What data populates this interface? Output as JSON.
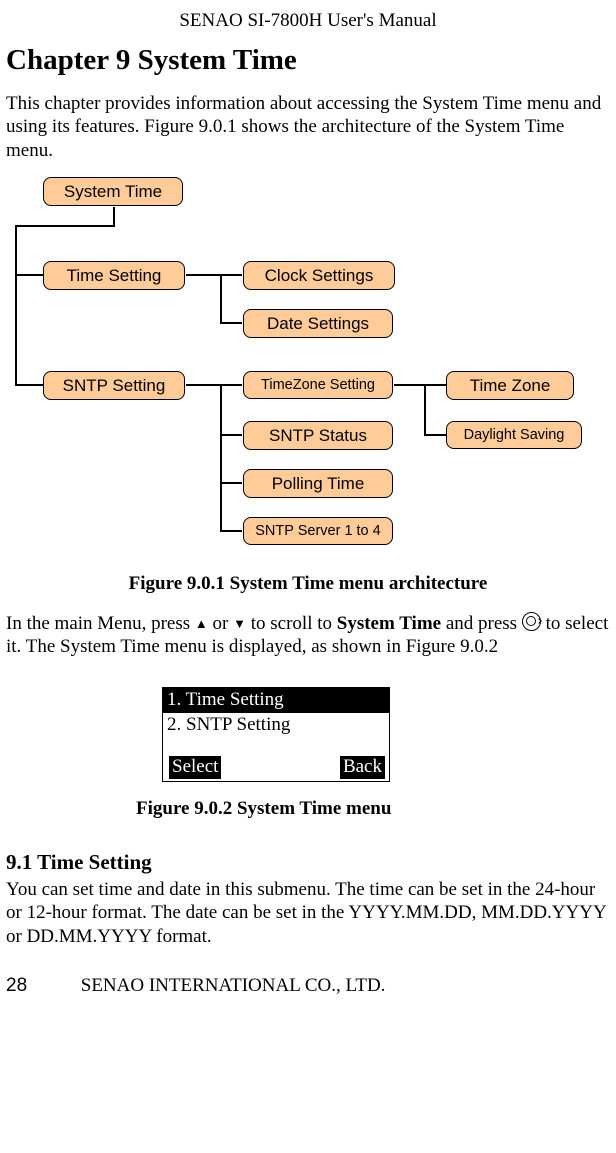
{
  "header": "SENAO SI-7800H User's Manual",
  "chapter_title": "Chapter 9 System Time",
  "intro": "This chapter provides information about accessing the System Time menu and using its features. Figure 9.0.1 shows the architecture of the System Time menu.",
  "diagram": {
    "system_time": "System Time",
    "time_setting": "Time Setting",
    "clock_settings": "Clock Settings",
    "date_settings": "Date Settings",
    "sntp_setting": "SNTP Setting",
    "timezone_setting": "TimeZone Setting",
    "sntp_status": "SNTP Status",
    "polling_time": "Polling Time",
    "sntp_server": "SNTP Server 1 to 4",
    "time_zone": "Time Zone",
    "daylight_saving": "Daylight Saving"
  },
  "figure1_caption": "Figure 9.0.1 System Time menu architecture",
  "instruction": {
    "part1": "In the main Menu, press ",
    "or": " or ",
    "part2": " to scroll to ",
    "bold_target": "System Time",
    "part3": " and press ",
    "part4": " to select it. The System Time menu is displayed, as shown in Figure 9.0.2"
  },
  "phone_menu": {
    "item1": "1. Time Setting",
    "item2": "2. SNTP Setting",
    "softkey_left": "Select",
    "softkey_right": "Back"
  },
  "figure2_caption": "Figure 9.0.2 System Time menu",
  "section_title": "9.1 Time Setting",
  "section_body": "You can set time and date in this submenu. The time can be set in the 24-hour or 12-hour format. The date can be set in the YYYY.MM.DD, MM.DD.YYYY or DD.MM.YYYY format.",
  "footer": {
    "page": "28",
    "company": "SENAO INTERNATIONAL CO., LTD."
  }
}
